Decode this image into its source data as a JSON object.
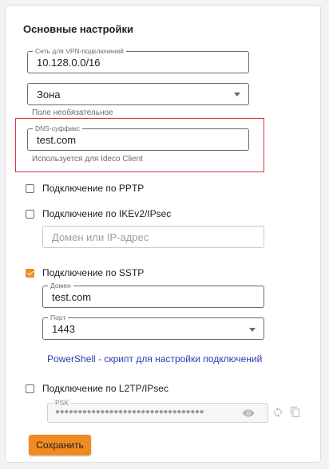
{
  "section": {
    "title": "Основные настройки"
  },
  "vpn_network": {
    "label": "Сеть для VPN-подключений",
    "value": "10.128.0.0/16"
  },
  "zone": {
    "value": "Зона",
    "helper": "Поле необязательное"
  },
  "dns_suffix": {
    "label": "DNS-суффикс",
    "value": "test.com",
    "helper": "Используется для Ideco Client"
  },
  "pptp": {
    "label": "Подключение по PPTP",
    "checked": false
  },
  "ikev2": {
    "label": "Подключение по IKEv2/IPsec",
    "checked": false,
    "domain_placeholder": "Домен или IP-адрес"
  },
  "sstp": {
    "label": "Подключение по SSTP",
    "checked": true,
    "domain_label": "Домен",
    "domain_value": "test.com",
    "port_label": "Порт",
    "port_value": "1443"
  },
  "powershell_link": "PowerShell - скрипт для настройки подключений",
  "l2tp": {
    "label": "Подключение по L2TP/IPsec",
    "checked": false,
    "psk_label": "PSK",
    "psk_masked": "●●●●●●●●●●●●●●●●●●●●●●●●●●●●●●●●●"
  },
  "save_label": "Сохранить",
  "colors": {
    "accent": "#ef8b22",
    "link": "#2d3bb5",
    "highlight": "#d9363e"
  },
  "icons": {
    "select_caret": "chevron-down-icon",
    "psk_visibility": "eye-icon",
    "psk_regenerate": "refresh-icon",
    "psk_copy": "copy-icon"
  }
}
